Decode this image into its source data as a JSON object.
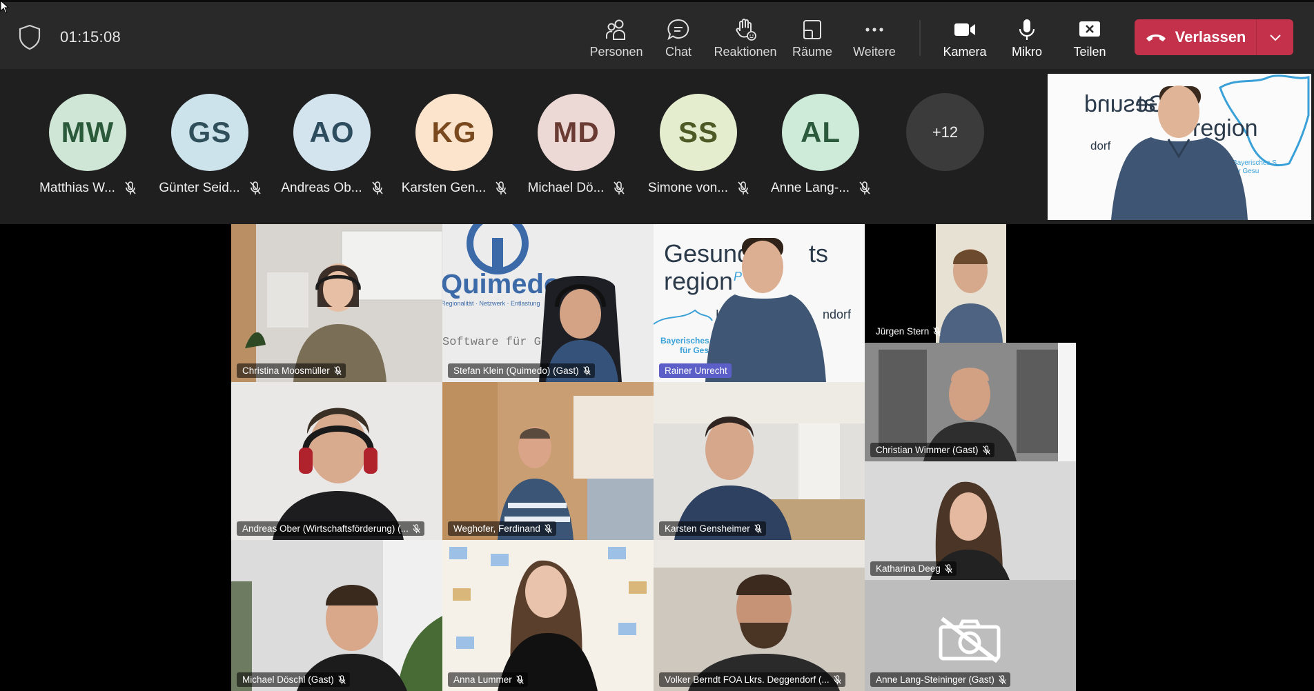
{
  "toolbar": {
    "timer": "01:15:08",
    "buttons": [
      {
        "label": "Personen",
        "icon": "people-icon"
      },
      {
        "label": "Chat",
        "icon": "chat-icon"
      },
      {
        "label": "Reaktionen",
        "icon": "raise-hand-icon"
      },
      {
        "label": "Räume",
        "icon": "rooms-icon"
      },
      {
        "label": "Weitere",
        "icon": "more-icon"
      },
      {
        "label": "Kamera",
        "icon": "camera-icon"
      },
      {
        "label": "Mikro",
        "icon": "microphone-icon"
      },
      {
        "label": "Teilen",
        "icon": "share-icon"
      }
    ],
    "leave_label": "Verlassen",
    "leave_color": "#c4314b"
  },
  "strip": {
    "participants": [
      {
        "initials": "MW",
        "name": "Matthias W...",
        "bg": "#cfe6d6",
        "fg": "#2a5a3a"
      },
      {
        "initials": "GS",
        "name": "Günter Seid...",
        "bg": "#cde3ec",
        "fg": "#2f4f5a"
      },
      {
        "initials": "AO",
        "name": "Andreas Ob...",
        "bg": "#d3e4ee",
        "fg": "#2d4d5e"
      },
      {
        "initials": "KG",
        "name": "Karsten Gen...",
        "bg": "#fbe3cc",
        "fg": "#7a4a1e"
      },
      {
        "initials": "MD",
        "name": "Michael Dö...",
        "bg": "#ecd9d6",
        "fg": "#6a3b33"
      },
      {
        "initials": "SS",
        "name": "Simone von...",
        "bg": "#e5edcf",
        "fg": "#4d5a26"
      },
      {
        "initials": "AL",
        "name": "Anne Lang-...",
        "bg": "#cdebd8",
        "fg": "#2b5a3d"
      }
    ],
    "overflow_count": "+12"
  },
  "tiles": [
    {
      "name": "Christina Moosmüller"
    },
    {
      "name": "Stefan Klein (Quimedo) (Gast)"
    },
    {
      "name": "Rainer Unrecht"
    },
    {
      "name": "Jürgen Stern"
    },
    {
      "name": "Andreas Ober (Wirtschaftsförderung) (..."
    },
    {
      "name": "Weghofer, Ferdinand"
    },
    {
      "name": "Karsten Gensheimer"
    },
    {
      "name": "Christian Wimmer (Gast)"
    },
    {
      "name": "Katharina Deeg"
    },
    {
      "name": "Michael Döschl (Gast)"
    },
    {
      "name": "Anna Lummer"
    },
    {
      "name": "Volker Berndt FOA Lkrs. Deggendorf (..."
    },
    {
      "name": "Anne Lang-Steininger (Gast)"
    }
  ],
  "backgrounds": {
    "quimedo_logo": "Quimedo",
    "quimedo_tagline": "Regionalität · Netzwerk · Entlastung",
    "quimedo_software": "Software für Gesundheits",
    "region_word1": "Gesund",
    "region_word2": "ts",
    "region_word3": "region",
    "region_suffix": "P",
    "region_place_left": "La",
    "region_place_right": "ndorf",
    "bavaria_line1": "Bayerisches S",
    "bavaria_line2": "für Gesu",
    "self_word1": "Gesund",
    "self_word2": "ts",
    "self_word3": "region",
    "self_place": "dorf",
    "self_bav1": "Bayerisches S",
    "self_bav2": "für Gesu"
  }
}
